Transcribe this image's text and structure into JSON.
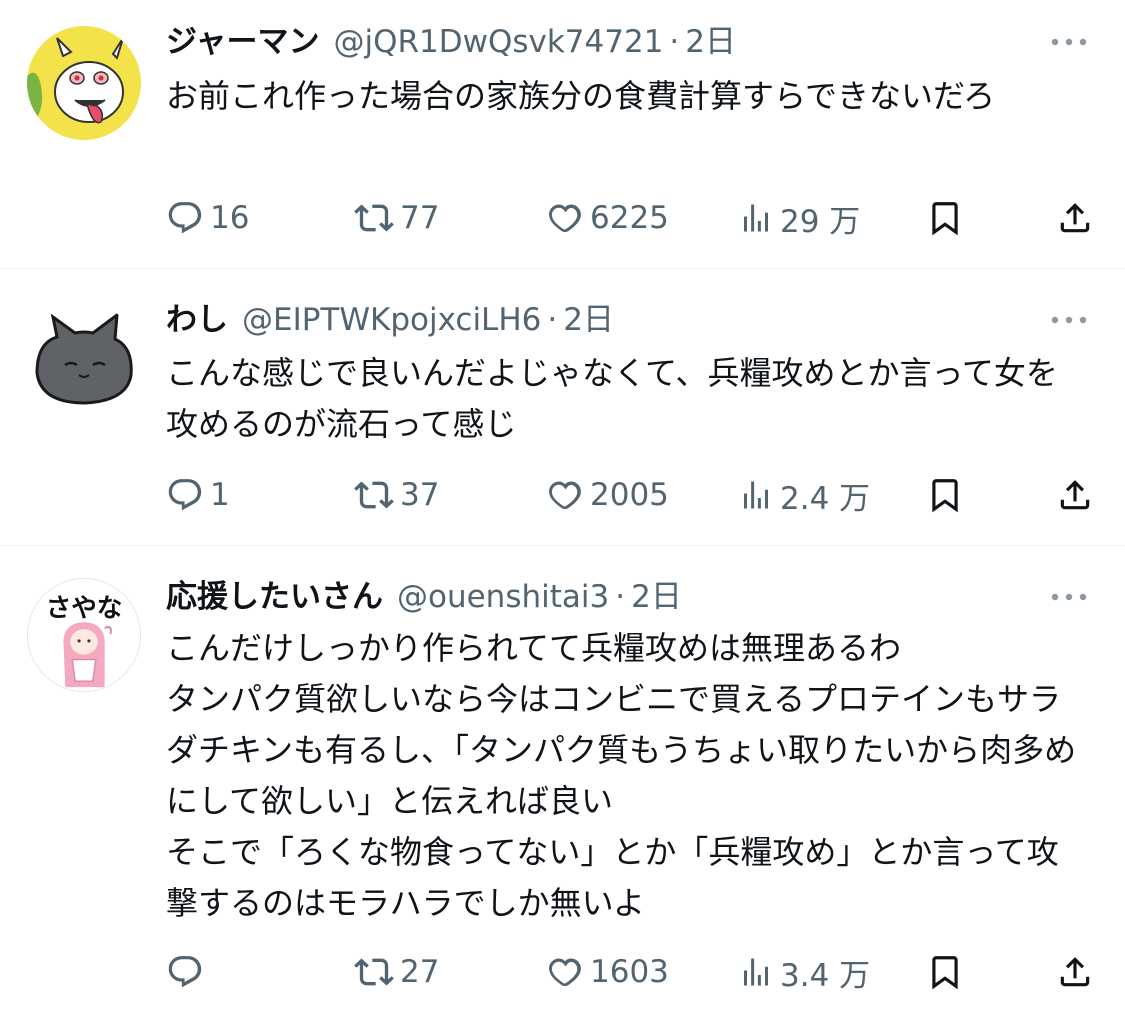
{
  "tweets": [
    {
      "name": "ジャーマン",
      "handle": "@jQR1DwQsvk74721",
      "dot": "·",
      "time": "2日",
      "text": "お前これ作った場合の家族分の食費計算すらできないだろ",
      "replies": "16",
      "retweets": "77",
      "likes": "6225",
      "views": "29 万",
      "avatar_icon": "goat-avatar"
    },
    {
      "name": "わし",
      "handle": "@EIPTWKpojxciLH6",
      "dot": "·",
      "time": "2日",
      "text": "こんな感じで良いんだよじゃなくて、兵糧攻めとか言って女を攻めるのが流石って感じ",
      "replies": "1",
      "retweets": "37",
      "likes": "2005",
      "views": "2.4 万",
      "avatar_icon": "gray-cat-avatar"
    },
    {
      "name": "応援したいさん",
      "handle": "@ouenshitai3",
      "dot": "·",
      "time": "2日",
      "text": "こんだけしっかり作られてて兵糧攻めは無理あるわ\nタンパク質欲しいなら今はコンビニで買えるプロテインもサラダチキンも有るし、「タンパク質もうちょい取りたいから肉多めにして欲しい」と伝えれば良い\nそこで「ろくな物食ってない」とか「兵糧攻め」とか言って攻撃するのはモラハラでしか無いよ",
      "replies": "",
      "retweets": "27",
      "likes": "1603",
      "views": "3.4 万",
      "avatar_icon": "pink-hair-girl-avatar",
      "avatar_text": "さやな"
    }
  ],
  "colors": {
    "text": "#0f1419",
    "secondary": "#536471",
    "divider": "#eff3f4"
  },
  "icons": [
    "reply-icon",
    "retweet-icon",
    "like-icon",
    "views-icon",
    "bookmark-icon",
    "share-icon",
    "more-icon"
  ]
}
